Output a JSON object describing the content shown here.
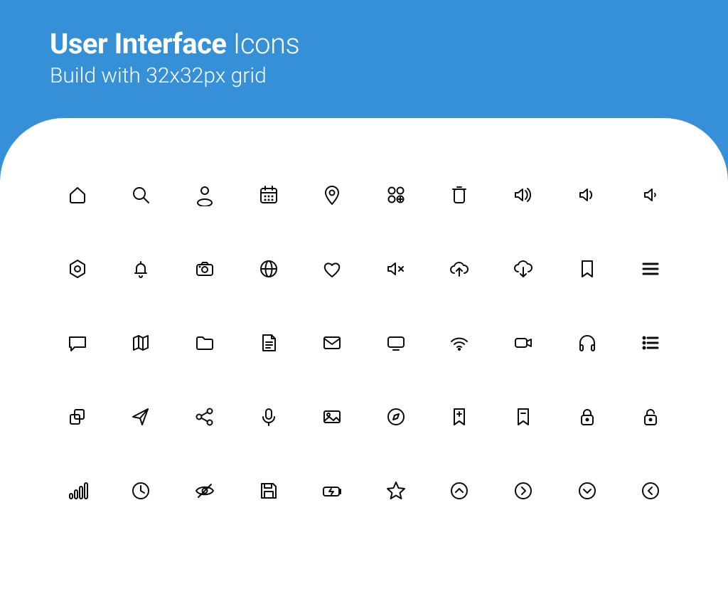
{
  "header": {
    "title_bold": "User Interface",
    "title_light": "Icons",
    "subtitle": "Build with 32x32px grid"
  },
  "icons": [
    [
      "home",
      "search",
      "user",
      "calendar",
      "location-pin",
      "apps-add",
      "trash",
      "volume-high",
      "volume-medium",
      "volume-low"
    ],
    [
      "settings-hex",
      "bell",
      "camera",
      "globe",
      "heart",
      "volume-mute",
      "cloud-upload",
      "cloud-download",
      "bookmark",
      "menu-lines"
    ],
    [
      "chat",
      "map",
      "folder",
      "document",
      "mail",
      "monitor",
      "wifi",
      "video-camera",
      "headphones",
      "list-bullets"
    ],
    [
      "copy",
      "send",
      "share",
      "microphone",
      "image",
      "compass",
      "bookmark-add",
      "bookmark-remove",
      "lock",
      "unlock"
    ],
    [
      "signal-bars",
      "clock",
      "eye-off",
      "save",
      "battery-charging",
      "star",
      "circle-chevron-up",
      "circle-chevron-right",
      "circle-chevron-down",
      "circle-chevron-left"
    ]
  ],
  "colors": {
    "bg": "#3690d8",
    "panel": "#ffffff",
    "stroke": "#0b0b0b"
  }
}
